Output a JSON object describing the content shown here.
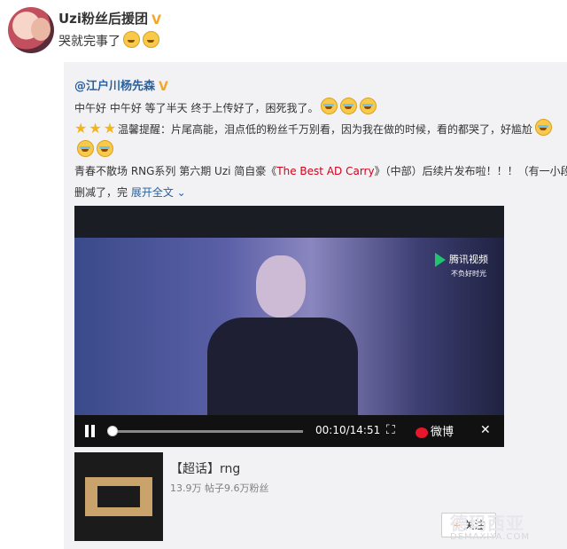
{
  "post": {
    "author": "Uzi粉丝后援团",
    "text": "哭就完事了"
  },
  "repost": {
    "author": "@江户川杨先森",
    "line1": "中午好 中午好 等了半天 终于上传好了，困死我了。",
    "line2": "温馨提醒：片尾高能，泪点低的粉丝千万别看，因为我在做的时候，看的都哭了，好尴尬",
    "line4_a": "青春不散场 RNG系列 第六期 Uzi 简自豪《",
    "line4_title": "The Best AD Carry",
    "line4_b": "》（中部）后续片发布啦！！！（有一小段",
    "line5": "删减了，完",
    "expand": "展开全文",
    "video": {
      "brand": "腾讯视频",
      "brand_sub": "不负好时光",
      "time": "00:10/14:51",
      "progress": 0.011,
      "weibo": "微博"
    },
    "card": {
      "title": "【超话】rng",
      "meta": "13.9万 帖子9.6万粉丝",
      "follow": "关注"
    }
  },
  "watermark": {
    "main": "德玛西亚",
    "sub": "DEMAXIYA.COM"
  }
}
